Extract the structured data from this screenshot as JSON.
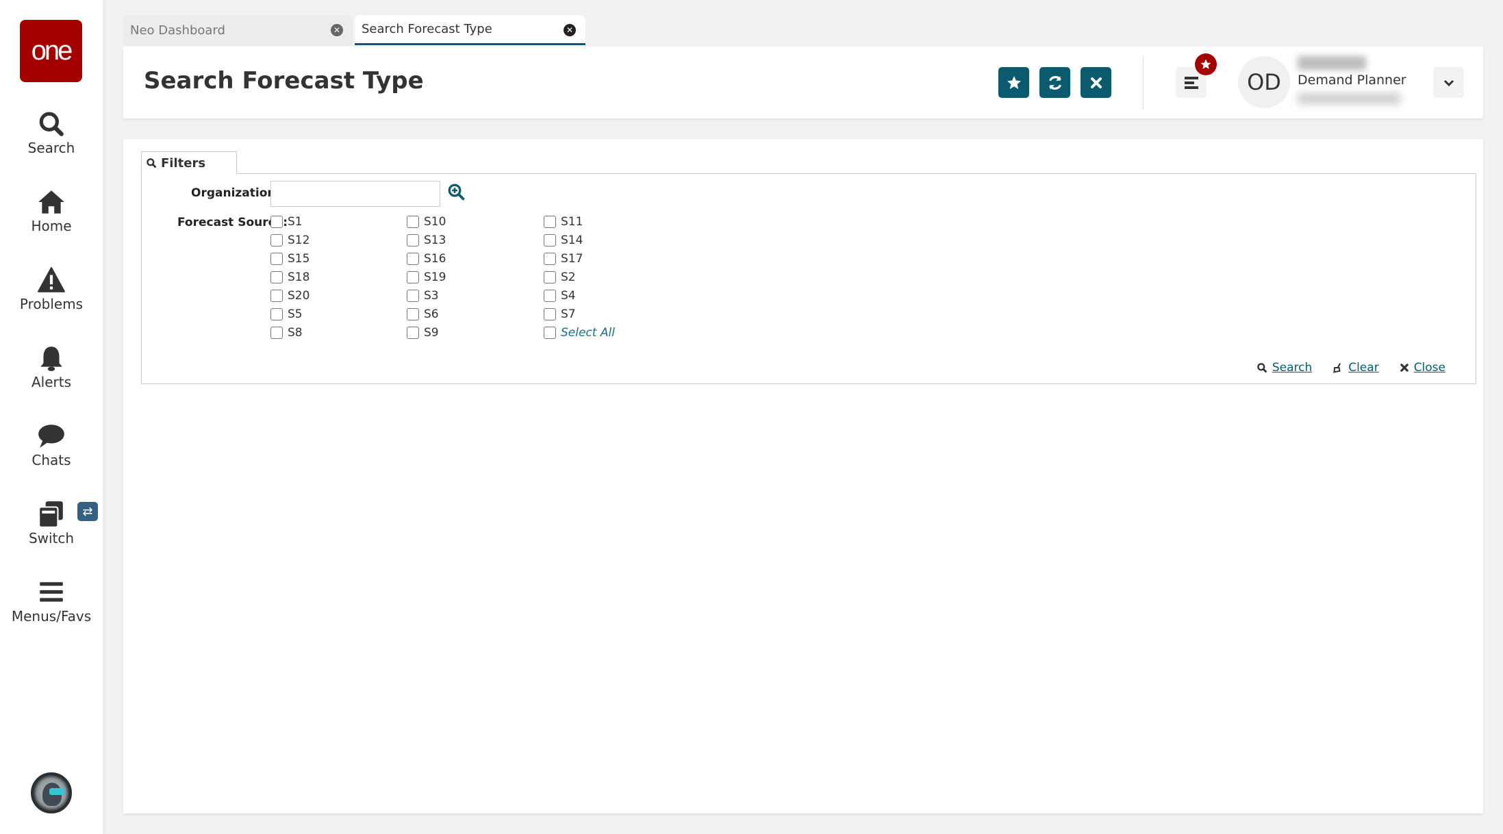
{
  "app": {
    "logo_text": "one",
    "brand_color": "#a50000",
    "accent_color": "#0a5b6e"
  },
  "sidebar": {
    "items": [
      {
        "label": "Search",
        "icon": "search-icon"
      },
      {
        "label": "Home",
        "icon": "home-icon"
      },
      {
        "label": "Problems",
        "icon": "warning-icon"
      },
      {
        "label": "Alerts",
        "icon": "bell-icon"
      },
      {
        "label": "Chats",
        "icon": "chat-bubble-icon"
      },
      {
        "label": "Switch",
        "icon": "switch-windows-icon"
      },
      {
        "label": "Menus/Favs",
        "icon": "hamburger-menu-icon"
      }
    ],
    "switch_badge_icon": "swap-arrows-icon",
    "bot_avatar_icon": "robot-assistant-icon"
  },
  "tabs": [
    {
      "label": "Neo Dashboard",
      "active": false
    },
    {
      "label": "Search Forecast Type",
      "active": true
    }
  ],
  "header": {
    "title": "Search Forecast Type",
    "buttons": [
      {
        "name": "favorite",
        "icon": "star-icon"
      },
      {
        "name": "refresh",
        "icon": "refresh-icon"
      },
      {
        "name": "close",
        "icon": "close-icon"
      }
    ],
    "menu_badge_icon": "star-icon",
    "user": {
      "initials": "OD",
      "role": "Demand Planner"
    }
  },
  "filters": {
    "tab_label": "Filters",
    "organization": {
      "label": "Organization:",
      "value": "",
      "placeholder": ""
    },
    "forecast_source": {
      "label": "Forecast Source:",
      "options": [
        [
          "S1",
          "S10",
          "S11"
        ],
        [
          "S12",
          "S13",
          "S14"
        ],
        [
          "S15",
          "S16",
          "S17"
        ],
        [
          "S18",
          "S19",
          "S2"
        ],
        [
          "S20",
          "S3",
          "S4"
        ],
        [
          "S5",
          "S6",
          "S7"
        ],
        [
          "S8",
          "S9",
          "Select All"
        ]
      ]
    },
    "actions": {
      "search": "Search",
      "clear": "Clear",
      "close": "Close"
    }
  }
}
